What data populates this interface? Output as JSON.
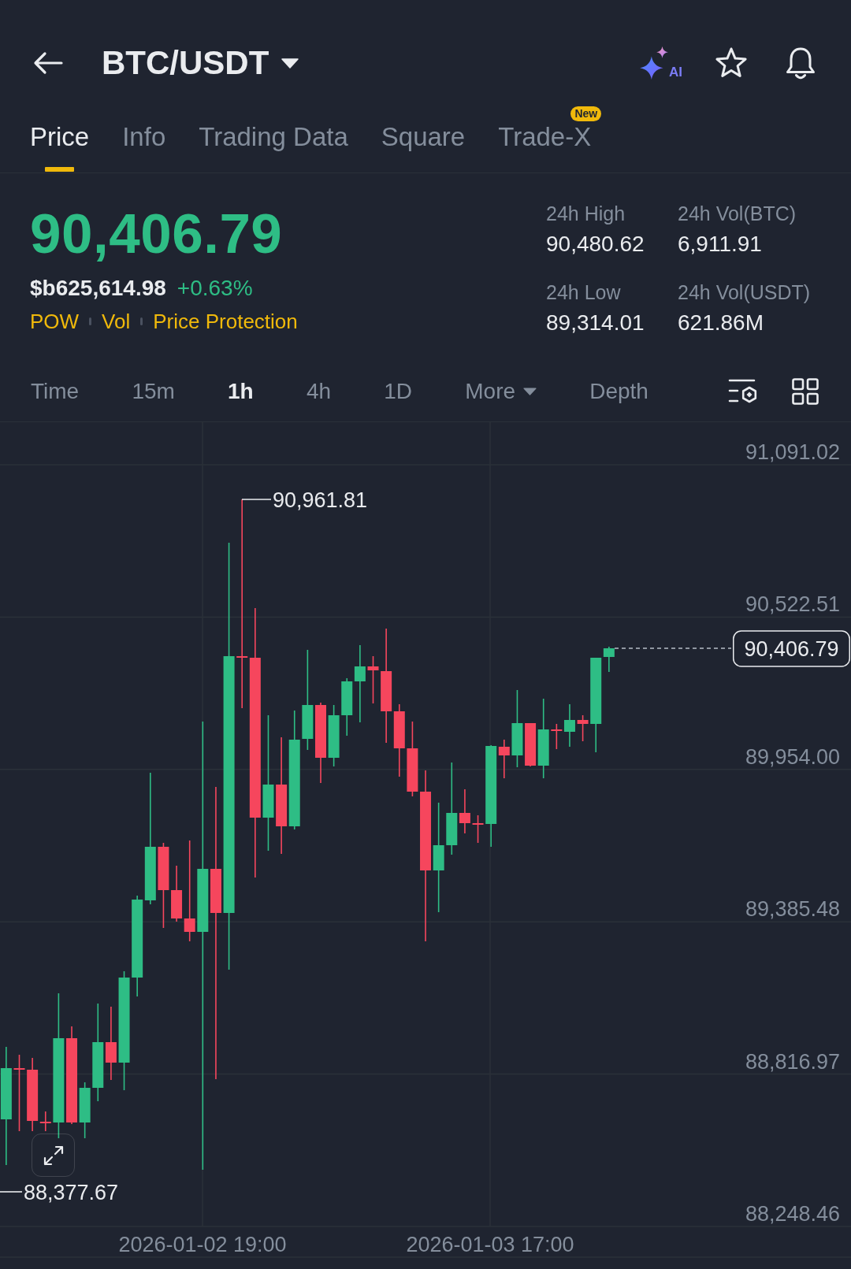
{
  "header": {
    "title": "BTC/USDT",
    "ai_label": "AI"
  },
  "tabs": [
    {
      "label": "Price",
      "selected": true
    },
    {
      "label": "Info",
      "selected": false
    },
    {
      "label": "Trading Data",
      "selected": false
    },
    {
      "label": "Square",
      "selected": false
    },
    {
      "label": "Trade-X",
      "selected": false,
      "badge": "New"
    }
  ],
  "ticker": {
    "last_price": "90,406.79",
    "fiat_value": "$b625,614.98",
    "change": "+0.63%",
    "tags": [
      "POW",
      "Vol",
      "Price Protection"
    ]
  },
  "stats": [
    {
      "label": "24h High",
      "value": "90,480.62"
    },
    {
      "label": "24h Vol(BTC)",
      "value": "6,911.91"
    },
    {
      "label": "24h Low",
      "value": "89,314.01"
    },
    {
      "label": "24h Vol(USDT)",
      "value": "621.86M"
    }
  ],
  "intervals": [
    {
      "label": "Time",
      "kind": "interval",
      "selected": false
    },
    {
      "label": "15m",
      "kind": "interval",
      "selected": false
    },
    {
      "label": "1h",
      "kind": "interval",
      "selected": true
    },
    {
      "label": "4h",
      "kind": "interval",
      "selected": false
    },
    {
      "label": "1D",
      "kind": "interval",
      "selected": false
    },
    {
      "label": "More",
      "kind": "menu",
      "selected": false
    },
    {
      "label": "Depth",
      "kind": "view",
      "selected": false
    }
  ],
  "chart": {
    "price_ticks": [
      "91,091.02",
      "90,522.51",
      "89,954.00",
      "89,385.48",
      "88,816.97",
      "88,248.46"
    ],
    "time_labels": [
      "2026-01-02 19:00",
      "2026-01-03 17:00"
    ],
    "high_label": "90,961.81",
    "low_label": "88,377.67",
    "last_price_tag": "90,406.79"
  }
}
